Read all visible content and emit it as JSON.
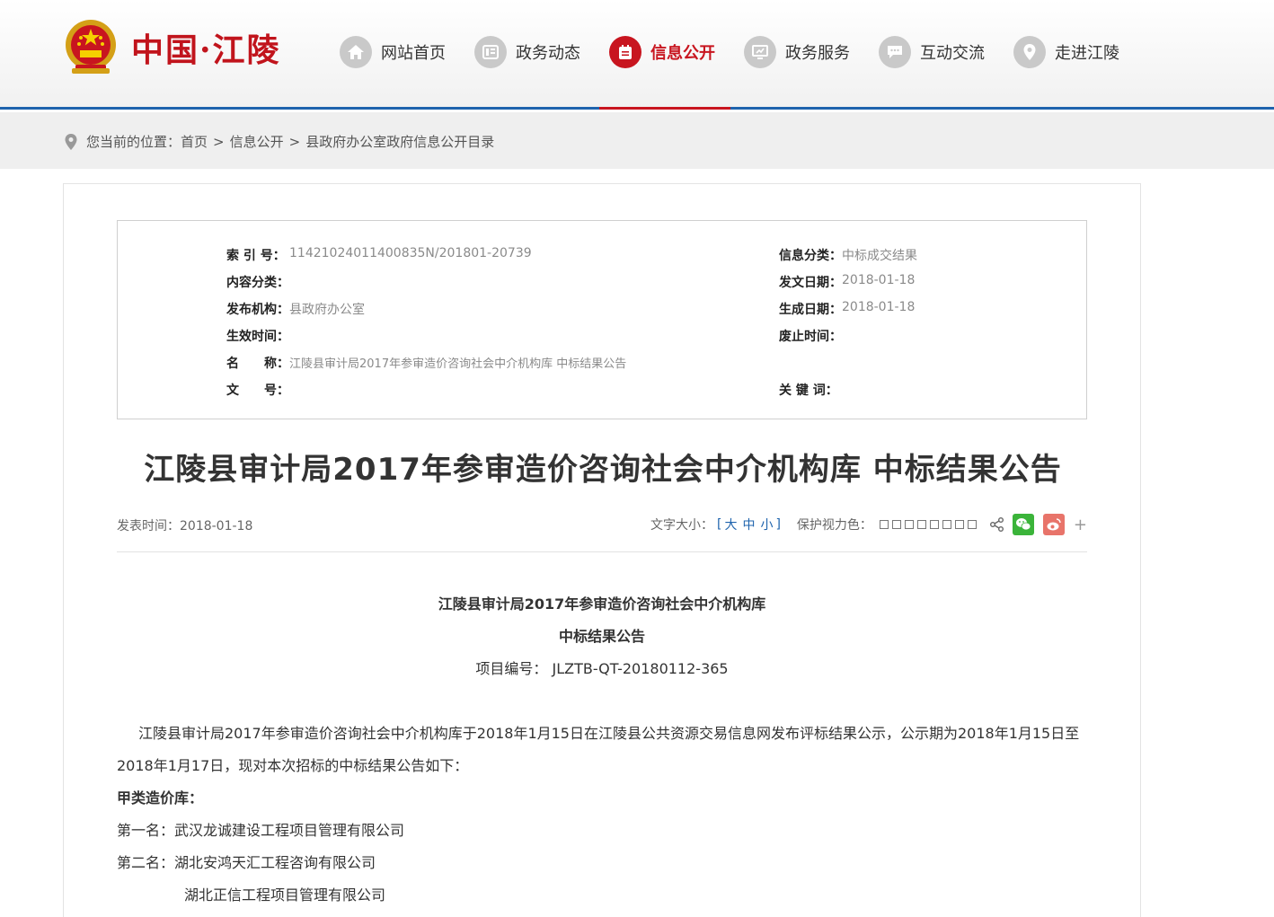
{
  "header": {
    "logo_text": "中国·江陵",
    "nav": [
      {
        "label": "网站首页",
        "icon": "home-icon"
      },
      {
        "label": "政务动态",
        "icon": "news-icon"
      },
      {
        "label": "信息公开",
        "icon": "calendar-icon",
        "active": true
      },
      {
        "label": "政务服务",
        "icon": "monitor-icon"
      },
      {
        "label": "互动交流",
        "icon": "chat-icon"
      },
      {
        "label": "走进江陵",
        "icon": "location-pin-icon"
      }
    ]
  },
  "breadcrumb": {
    "prefix": "您当前的位置：",
    "items": [
      "首页",
      "信息公开",
      "县政府办公室政府信息公开目录"
    ],
    "separator": ">"
  },
  "meta": {
    "index_no_label": "索 引 号：",
    "index_no": "11421024011400835N/201801-20739",
    "category_label": "信息分类：",
    "category": "中标成交结果",
    "content_cat_label": "内容分类：",
    "content_cat": "",
    "issue_date_label": "发文日期：",
    "issue_date": "2018-01-18",
    "publisher_label": "发布机构：",
    "publisher": "县政府办公室",
    "created_label": "生成日期：",
    "created": "2018-01-18",
    "effective_label": "生效时间：",
    "effective": "",
    "expiry_label": "废止时间：",
    "expiry": "",
    "name_label": "名　　称：",
    "name": "江陵县审计局2017年参审造价咨询社会中介机构库 中标结果公告",
    "doc_no_label": "文　　号：",
    "doc_no": "",
    "keywords_label": "关 键 词：",
    "keywords": ""
  },
  "article": {
    "title": "江陵县审计局2017年参审造价咨询社会中介机构库 中标结果公告",
    "pub_time": "发表时间：2018-01-18",
    "font_size_label": "文字大小：",
    "font_sizes": [
      "大",
      "中",
      "小"
    ],
    "bracket_open": "[",
    "bracket_close": "]",
    "eye_color_label": "保护视力色：",
    "swatch_count": 8,
    "body": {
      "heading1": "江陵县审计局2017年参审造价咨询社会中介机构库",
      "heading2": "中标结果公告",
      "project_no": "项目编号： JLZTB-QT-20180112-365",
      "paragraph": "江陵县审计局2017年参审造价咨询社会中介机构库于2018年1月15日在江陵县公共资源交易信息网发布评标结果公示，公示期为2018年1月15日至2018年1月17日，现对本次招标的中标结果公告如下：",
      "section_a": "甲类造价库：",
      "first": "第一名：武汉龙诚建设工程项目管理有限公司",
      "second": "第二名：湖北安鸿天汇工程咨询有限公司",
      "second_b": "湖北正信工程项目管理有限公司"
    }
  },
  "colors": {
    "accent_red": "#c8151f",
    "nav_blue": "#1e63ad",
    "wechat_green": "#3bb43a",
    "weibo_red": "#e8746a"
  }
}
